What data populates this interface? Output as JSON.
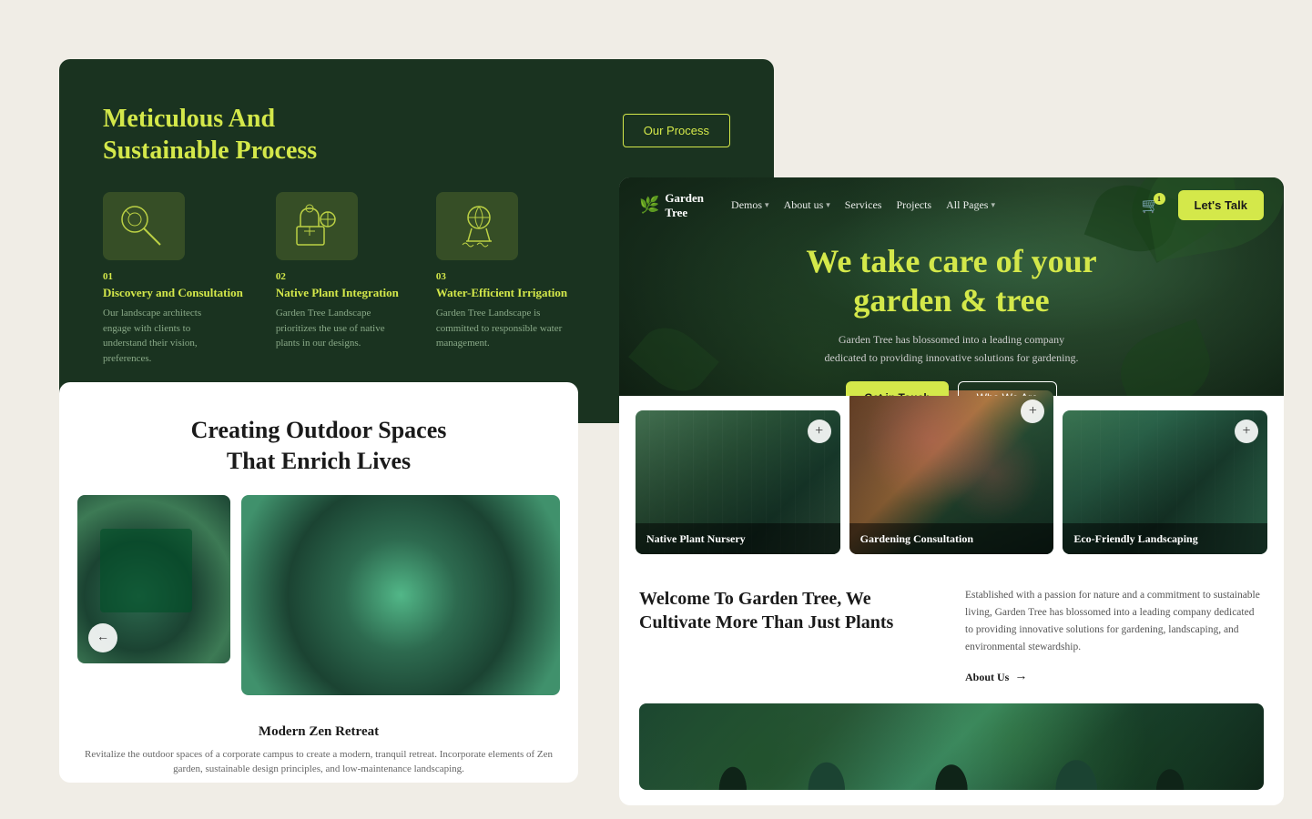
{
  "back_card": {
    "title": "Meticulous And\nSustainable Process",
    "process_btn": "Our Process",
    "steps": [
      {
        "num": "01",
        "title": "Discovery and Consultation",
        "desc": "Our landscape architects engage with clients to understand their vision, preferences."
      },
      {
        "num": "02",
        "title": "Native Plant Integration",
        "desc": "Garden Tree Landscape prioritizes the use of native plants in our designs."
      },
      {
        "num": "03",
        "title": "Water-Efficient Irrigation",
        "desc": "Garden Tree Landscape is committed to responsible water management."
      }
    ]
  },
  "mid_card": {
    "title": "Creating Outdoor Spaces\nThat Enrich Lives",
    "zen_label": "Modern Zen Retreat",
    "zen_desc": "Revitalize the outdoor spaces of a corporate campus to create a modern, tranquil retreat. Incorporate elements of Zen garden, sustainable design principles, and low-maintenance landscaping."
  },
  "front_card": {
    "navbar": {
      "logo_line1": "Garden",
      "logo_line2": "Tree",
      "links": [
        "Demos",
        "About us",
        "Services",
        "Projects",
        "All Pages"
      ],
      "cart_count": "1",
      "lets_talk": "Let's Talk"
    },
    "hero": {
      "title": "We take care of your\ngarden & tree",
      "subtitle": "Garden Tree has blossomed into a leading company dedicated to providing innovative solutions for gardening.",
      "btn_contact": "Get in Touch",
      "btn_about": "Who We Are"
    },
    "services": [
      {
        "label": "Native Plant Nursery"
      },
      {
        "label": "Gardening Consultation"
      },
      {
        "label": "Eco-Friendly Landscaping"
      }
    ],
    "about": {
      "title": "Welcome To Garden Tree, We Cultivate More Than Just Plants",
      "desc": "Established with a passion for nature and a commitment to sustainable living, Garden Tree has blossomed into a leading company dedicated to providing innovative solutions for gardening, landscaping, and environmental stewardship.",
      "link": "About Us"
    }
  }
}
